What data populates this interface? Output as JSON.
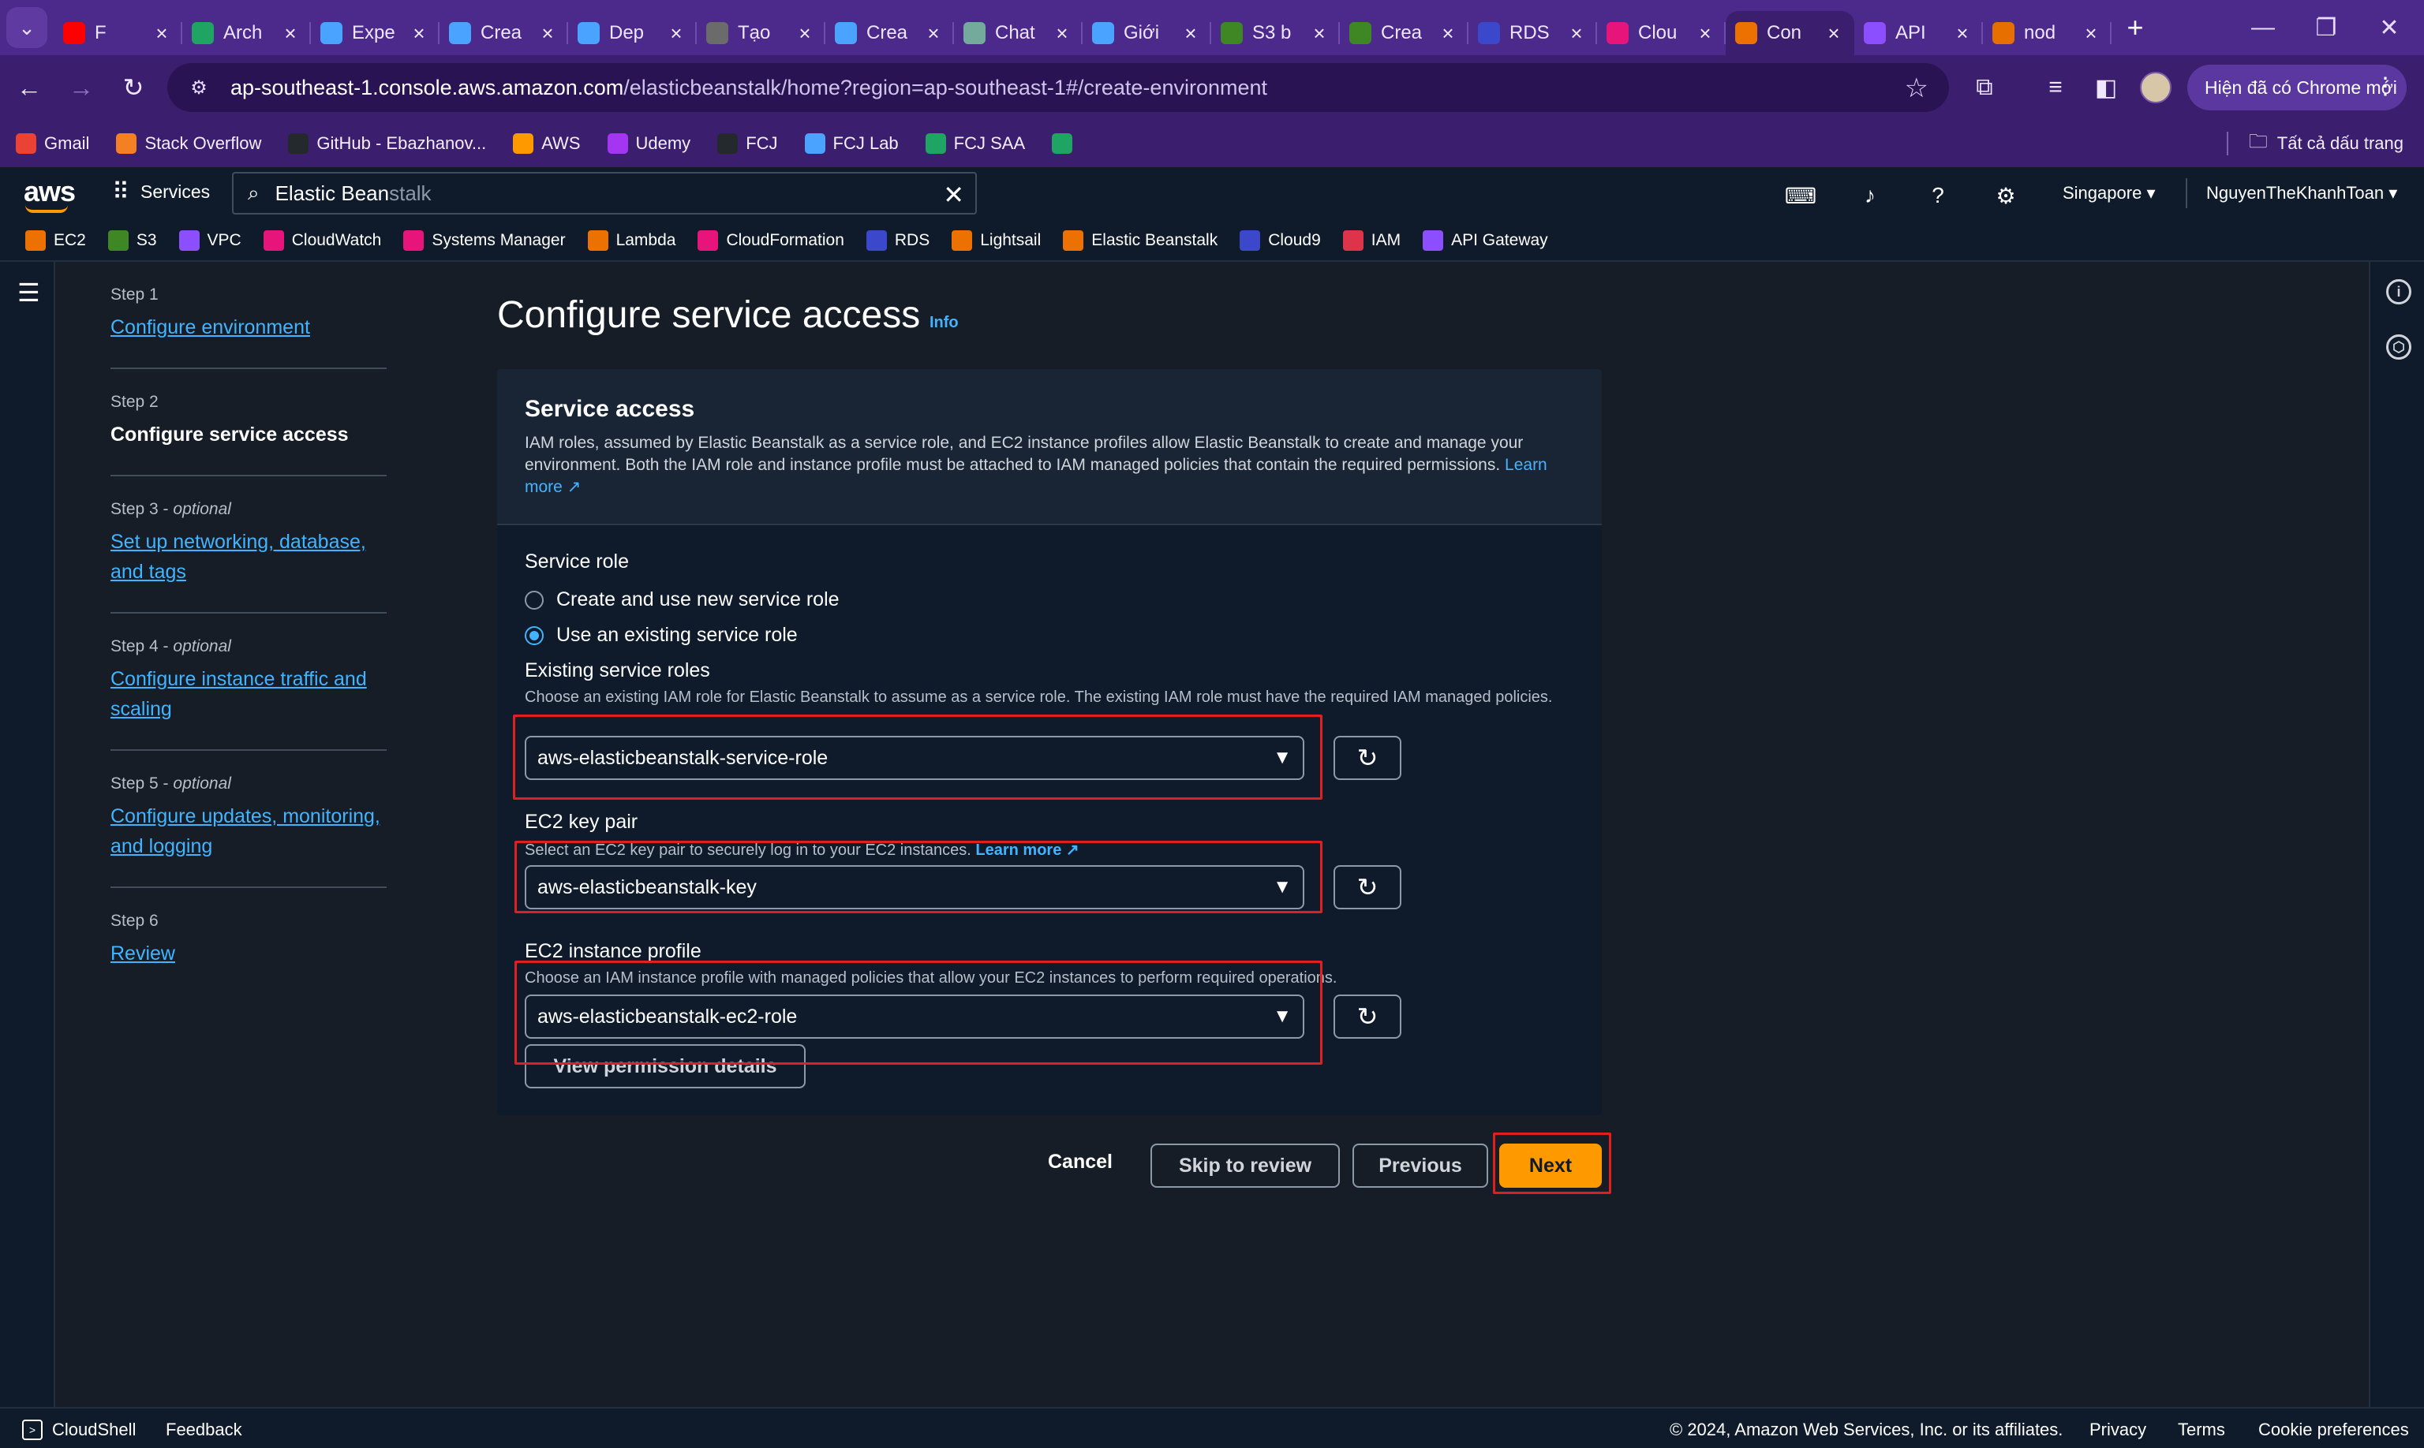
{
  "browser": {
    "tabs": [
      {
        "label": "F",
        "icon": "youtube-icon",
        "color": "#ff0000",
        "active": false
      },
      {
        "label": "Arch",
        "icon": "drive-icon",
        "color": "#1fa463",
        "active": false
      },
      {
        "label": "Expe",
        "icon": "udemy-icon",
        "color": "#4aa3ff",
        "active": false
      },
      {
        "label": "Crea",
        "icon": "udemy-icon",
        "color": "#4aa3ff",
        "active": false
      },
      {
        "label": "Dep",
        "icon": "udemy-icon",
        "color": "#4aa3ff",
        "active": false
      },
      {
        "label": "Tạo",
        "icon": "github-icon",
        "color": "#6b6b6b",
        "active": false
      },
      {
        "label": "Crea",
        "icon": "udemy-icon",
        "color": "#4aa3ff",
        "active": false
      },
      {
        "label": "Chat",
        "icon": "chatgpt-icon",
        "color": "#74aa9c",
        "active": false
      },
      {
        "label": "Giới",
        "icon": "udemy-icon",
        "color": "#4aa3ff",
        "active": false
      },
      {
        "label": "S3 b",
        "icon": "s3-icon",
        "color": "#3f8624",
        "active": false
      },
      {
        "label": "Crea",
        "icon": "s3-icon",
        "color": "#3f8624",
        "active": false
      },
      {
        "label": "RDS",
        "icon": "rds-icon",
        "color": "#3b48cc",
        "active": false
      },
      {
        "label": "Clou",
        "icon": "cloudformation-icon",
        "color": "#e7157b",
        "active": false
      },
      {
        "label": "Con",
        "icon": "beanstalk-icon",
        "color": "#ed7100",
        "active": true
      },
      {
        "label": "API",
        "icon": "apigateway-icon",
        "color": "#8c4fff",
        "active": false
      },
      {
        "label": "nod",
        "icon": "java-icon",
        "color": "#e76f00",
        "active": false
      }
    ],
    "url_host": "ap-southeast-1.console.aws.amazon.com",
    "url_path": "/elasticbeanstalk/home?region=ap-southeast-1#/create-environment",
    "update_button": "Hiện đã có Chrome mới",
    "bookmarks": [
      {
        "label": "Gmail",
        "icon": "gmail-icon",
        "color": "#ea4335"
      },
      {
        "label": "Stack Overflow",
        "icon": "stackoverflow-icon",
        "color": "#f48024"
      },
      {
        "label": "GitHub - Ebazhanov...",
        "icon": "github-icon",
        "color": "#24292e"
      },
      {
        "label": "AWS",
        "icon": "aws-cube-icon",
        "color": "#ff9900"
      },
      {
        "label": "Udemy",
        "icon": "udemy-icon",
        "color": "#a435f0"
      },
      {
        "label": "FCJ",
        "icon": "github-icon",
        "color": "#24292e"
      },
      {
        "label": "FCJ Lab",
        "icon": "fcj-icon",
        "color": "#4aa3ff"
      },
      {
        "label": "FCJ SAA",
        "icon": "drive-icon",
        "color": "#1fa463"
      },
      {
        "label": "",
        "icon": "drive-icon",
        "color": "#1fa463"
      }
    ],
    "all_bookmarks": "Tất cả dấu trang"
  },
  "aws": {
    "logo": "aws",
    "services": "Services",
    "search_typed": "Elastic Bean",
    "search_ghost": "stalk",
    "region": "Singapore",
    "user": "NguyenTheKhanhToan",
    "favorites": [
      {
        "label": "EC2",
        "color": "#ed7100"
      },
      {
        "label": "S3",
        "color": "#3f8624"
      },
      {
        "label": "VPC",
        "color": "#8c4fff"
      },
      {
        "label": "CloudWatch",
        "color": "#e7157b"
      },
      {
        "label": "Systems Manager",
        "color": "#e7157b"
      },
      {
        "label": "Lambda",
        "color": "#ed7100"
      },
      {
        "label": "CloudFormation",
        "color": "#e7157b"
      },
      {
        "label": "RDS",
        "color": "#3b48cc"
      },
      {
        "label": "Lightsail",
        "color": "#ed7100"
      },
      {
        "label": "Elastic Beanstalk",
        "color": "#ed7100"
      },
      {
        "label": "Cloud9",
        "color": "#3b48cc"
      },
      {
        "label": "IAM",
        "color": "#dd344c"
      },
      {
        "label": "API Gateway",
        "color": "#8c4fff"
      }
    ]
  },
  "steps": [
    {
      "label": "Step 1",
      "optional": "",
      "name": "Configure environment",
      "current": false
    },
    {
      "label": "Step 2",
      "optional": "",
      "name": "Configure service access",
      "current": true
    },
    {
      "label": "Step 3 - ",
      "optional": "optional",
      "name": "Set up networking, database, and tags",
      "current": false
    },
    {
      "label": "Step 4 - ",
      "optional": "optional",
      "name": "Configure instance traffic and scaling",
      "current": false
    },
    {
      "label": "Step 5 - ",
      "optional": "optional",
      "name": "Configure updates, monitoring, and logging",
      "current": false
    },
    {
      "label": "Step 6",
      "optional": "",
      "name": "Review",
      "current": false
    }
  ],
  "page": {
    "title": "Configure service access",
    "info": "Info"
  },
  "service_access": {
    "title": "Service access",
    "description": "IAM roles, assumed by Elastic Beanstalk as a service role, and EC2 instance profiles allow Elastic Beanstalk to create and manage your environment. Both the IAM role and instance profile must be attached to IAM managed policies that contain the required permissions.",
    "learn_more": "Learn more",
    "service_role_label": "Service role",
    "radio_new": "Create and use new service role",
    "radio_existing": "Use an existing service role",
    "selected_radio": "existing",
    "existing_roles_label": "Existing service roles",
    "existing_roles_desc": "Choose an existing IAM role for Elastic Beanstalk to assume as a service role. The existing IAM role must have the required IAM managed policies.",
    "existing_roles_value": "aws-elasticbeanstalk-service-role",
    "key_pair_label": "EC2 key pair",
    "key_pair_desc": "Select an EC2 key pair to securely log in to your EC2 instances.",
    "key_pair_learn_more": "Learn more",
    "key_pair_value": "aws-elasticbeanstalk-key",
    "instance_profile_label": "EC2 instance profile",
    "instance_profile_desc": "Choose an IAM instance profile with managed policies that allow your EC2 instances to perform required operations.",
    "instance_profile_value": "aws-elasticbeanstalk-ec2-role",
    "view_permissions": "View permission details"
  },
  "actions": {
    "cancel": "Cancel",
    "skip": "Skip to review",
    "previous": "Previous",
    "next": "Next"
  },
  "footer": {
    "cloudshell": "CloudShell",
    "feedback": "Feedback",
    "copyright": "© 2024, Amazon Web Services, Inc. or its affiliates.",
    "privacy": "Privacy",
    "terms": "Terms",
    "cookies": "Cookie preferences"
  },
  "colors": {
    "annotation": "#e02020",
    "accent": "#ff9900",
    "link": "#42b4ff",
    "chrome": "#4c2a8c"
  }
}
